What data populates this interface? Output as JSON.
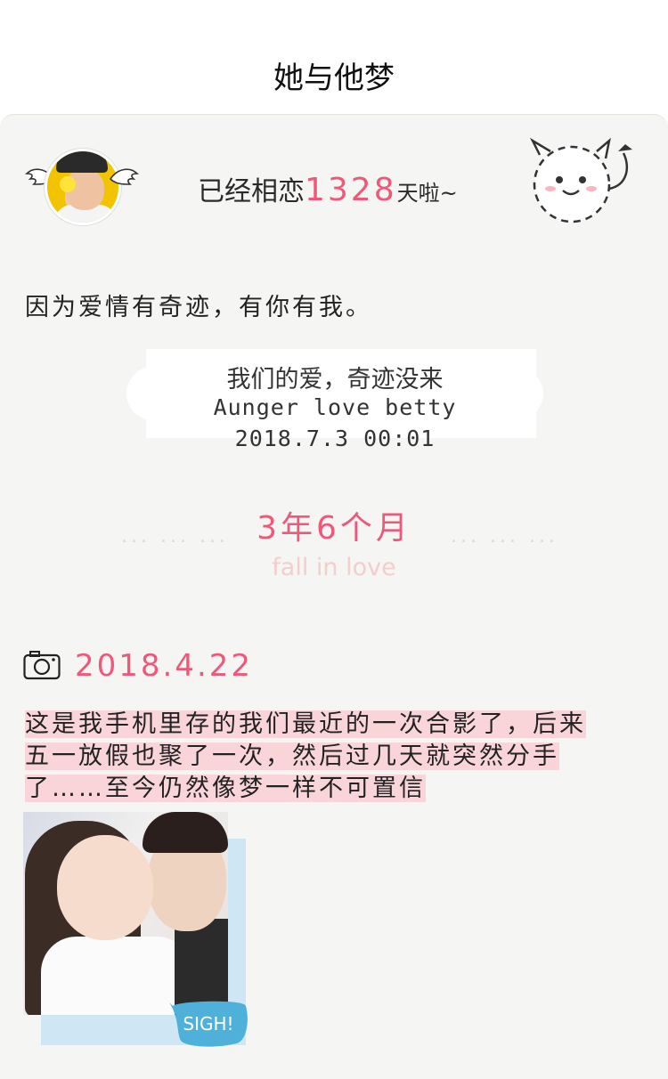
{
  "header": {
    "title": "她与他梦"
  },
  "counter": {
    "prefix": "已经相恋",
    "days": "1328",
    "suffix": "天啦~"
  },
  "quote": "因为爱情有奇迹，有你有我。",
  "cloud": {
    "line1": "我们的爱，奇迹没来",
    "line2": "Aunger love betty",
    "line3": "2018.7.3 00:01"
  },
  "duration": {
    "text": "3年6个月",
    "dots_left": "... ... ...",
    "dots_right": "... ... ...",
    "subtitle": "fall in love"
  },
  "entry": {
    "date": "2018.4.22",
    "lines": [
      "这是我手机里存的我们最近的一次合影了，后来",
      "五一放假也聚了一次，然后过几天就突然分手",
      "了……至今仍然像梦一样不可置信"
    ],
    "sticker": "SIGH!"
  },
  "colors": {
    "accent": "#f0587a",
    "highlight": "#f9d5d9",
    "card_bg": "#f5f5f3",
    "photo_back": "#cfe7f4"
  }
}
